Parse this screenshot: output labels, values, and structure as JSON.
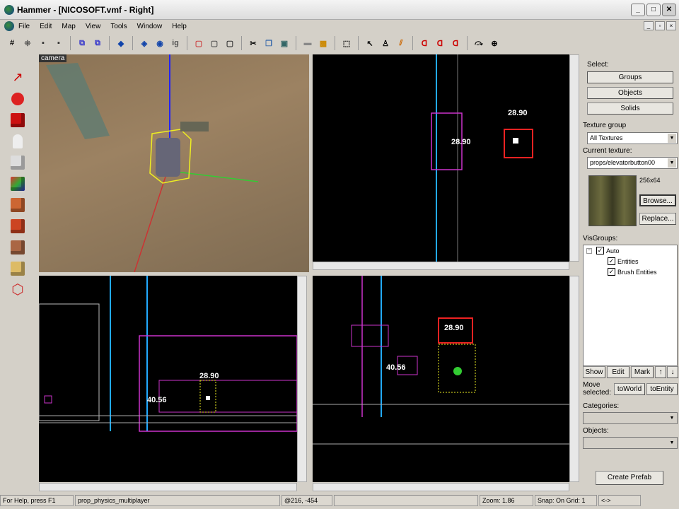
{
  "window": {
    "title": "Hammer - [NICOSOFT.vmf - Right]"
  },
  "menu": [
    "File",
    "Edit",
    "Map",
    "View",
    "Tools",
    "Window",
    "Help"
  ],
  "viewports": {
    "camera_label": "camera",
    "dim_top": "28.90",
    "dim_top_b": "28.90",
    "dim_bl_a": "28.90",
    "dim_bl_b": "40.56",
    "dim_br_a": "28.90",
    "dim_br_b": "40.56"
  },
  "panel": {
    "select_label": "Select:",
    "groups": "Groups",
    "objects": "Objects",
    "solids": "Solids",
    "texture_group_label": "Texture group",
    "texture_group_value": "All Textures",
    "current_texture_label": "Current texture:",
    "current_texture_value": "props/elevatorbutton00",
    "texture_size": "256x64",
    "browse": "Browse...",
    "replace": "Replace...",
    "visgroups_label": "VisGroups:",
    "visgroups": [
      "Auto",
      "Entities",
      "Brush Entities"
    ],
    "show": "Show",
    "edit": "Edit",
    "mark": "Mark",
    "up": "↑",
    "down": "↓",
    "move_selected": "Move selected:",
    "to_world": "toWorld",
    "to_entity": "toEntity",
    "categories_label": "Categories:",
    "objects_label": "Objects:",
    "create_prefab": "Create Prefab"
  },
  "status": {
    "help": "For Help, press F1",
    "selection": "prop_physics_multiplayer",
    "coords": "@216, -454",
    "zoom": "Zoom: 1.86",
    "snap": "Snap: On Grid: 1",
    "extra": "<->"
  }
}
